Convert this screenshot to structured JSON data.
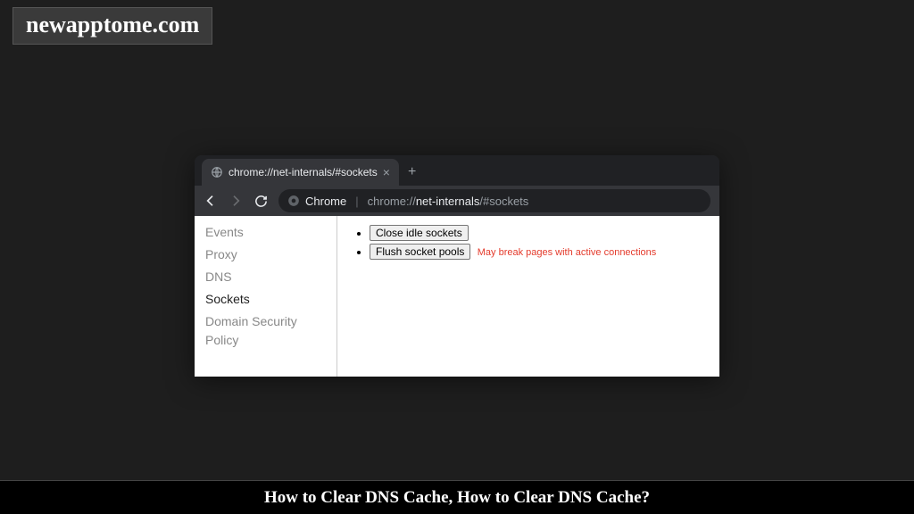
{
  "watermark": "newapptome.com",
  "browser": {
    "tab": {
      "title": "chrome://net-internals/#sockets"
    },
    "address": {
      "scheme": "Chrome",
      "path_prefix": "chrome://",
      "path_bold": "net-internals",
      "path_suffix": "/#sockets"
    },
    "sidebar": {
      "items": [
        {
          "label": "Events",
          "active": false
        },
        {
          "label": "Proxy",
          "active": false
        },
        {
          "label": "DNS",
          "active": false
        },
        {
          "label": "Sockets",
          "active": true
        },
        {
          "label": "Domain Security Policy",
          "active": false
        }
      ]
    },
    "actions": {
      "close_idle": "Close idle sockets",
      "flush_pools": "Flush socket pools",
      "flush_warning": "May break pages with active connections"
    }
  },
  "caption": "How to Clear DNS Cache, How to Clear DNS Cache?"
}
